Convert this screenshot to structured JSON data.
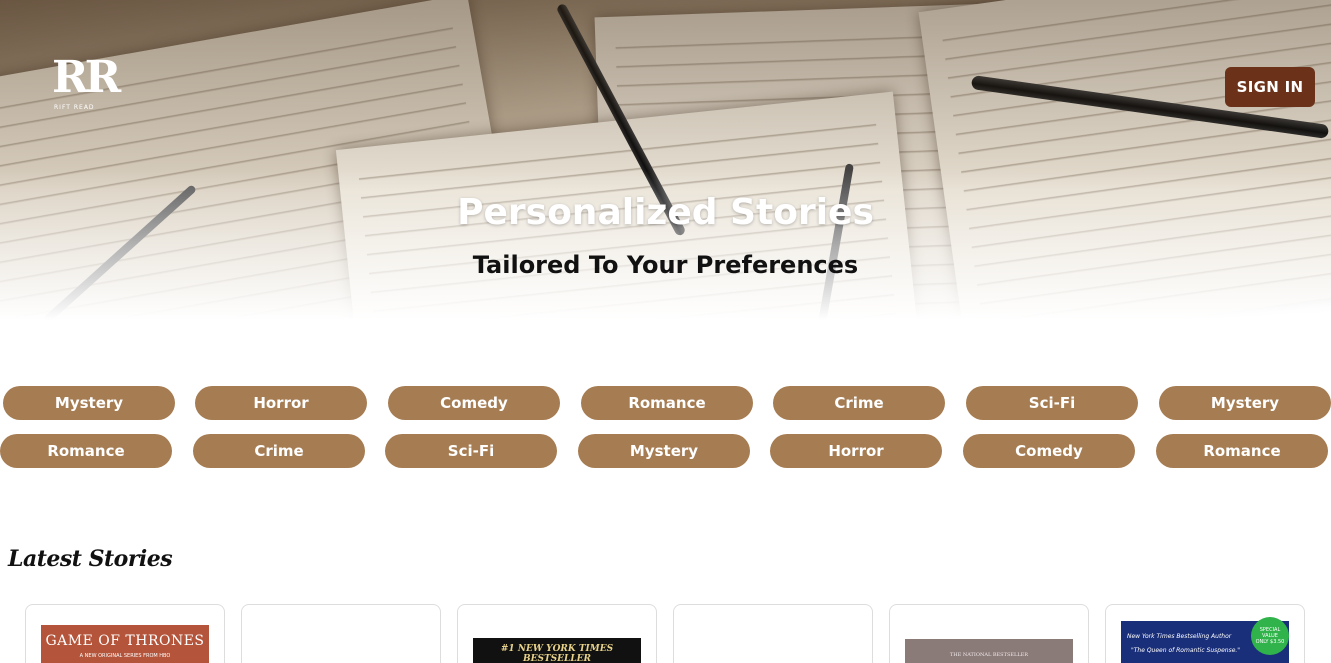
{
  "brand": {
    "logo_mark": "RR",
    "logo_text": "RIFT READ"
  },
  "header": {
    "signin_label": "SIGN IN"
  },
  "hero": {
    "title": "Personalized Stories",
    "subtitle": "Tailored To Your Preferences"
  },
  "genres": {
    "row1": [
      "Mystery",
      "Horror",
      "Comedy",
      "Romance",
      "Crime",
      "Sci-Fi",
      "Mystery"
    ],
    "row2": [
      "Romance",
      "Crime",
      "Sci-Fi",
      "Mystery",
      "Horror",
      "Comedy",
      "Romance"
    ]
  },
  "latest": {
    "title": "Latest Stories",
    "covers": [
      {
        "top_text": "GAME OF THRONES",
        "sub_text": "A NEW ORIGINAL SERIES FROM HBO",
        "color": "#b4543a"
      },
      {
        "top_text": "",
        "sub_text": "",
        "color": "#ffffff"
      },
      {
        "top_text": "#1 NEW YORK TIMES BESTSELLER",
        "sub_text": "",
        "color": "#111111"
      },
      {
        "top_text": "",
        "sub_text": "",
        "color": "#ffffff"
      },
      {
        "top_text": "THE NATIONAL BESTSELLER",
        "sub_text": "",
        "color": "#8a7a78"
      },
      {
        "top_text": "New York Times Bestselling Author",
        "sub_text": "\"The Queen of Romantic Suspense.\"",
        "badge": "SPECIAL VALUE ONLY $3.50",
        "color": "#1a2f7a"
      }
    ]
  },
  "colors": {
    "pill": "#a67c52",
    "signin": "#6b3219"
  }
}
